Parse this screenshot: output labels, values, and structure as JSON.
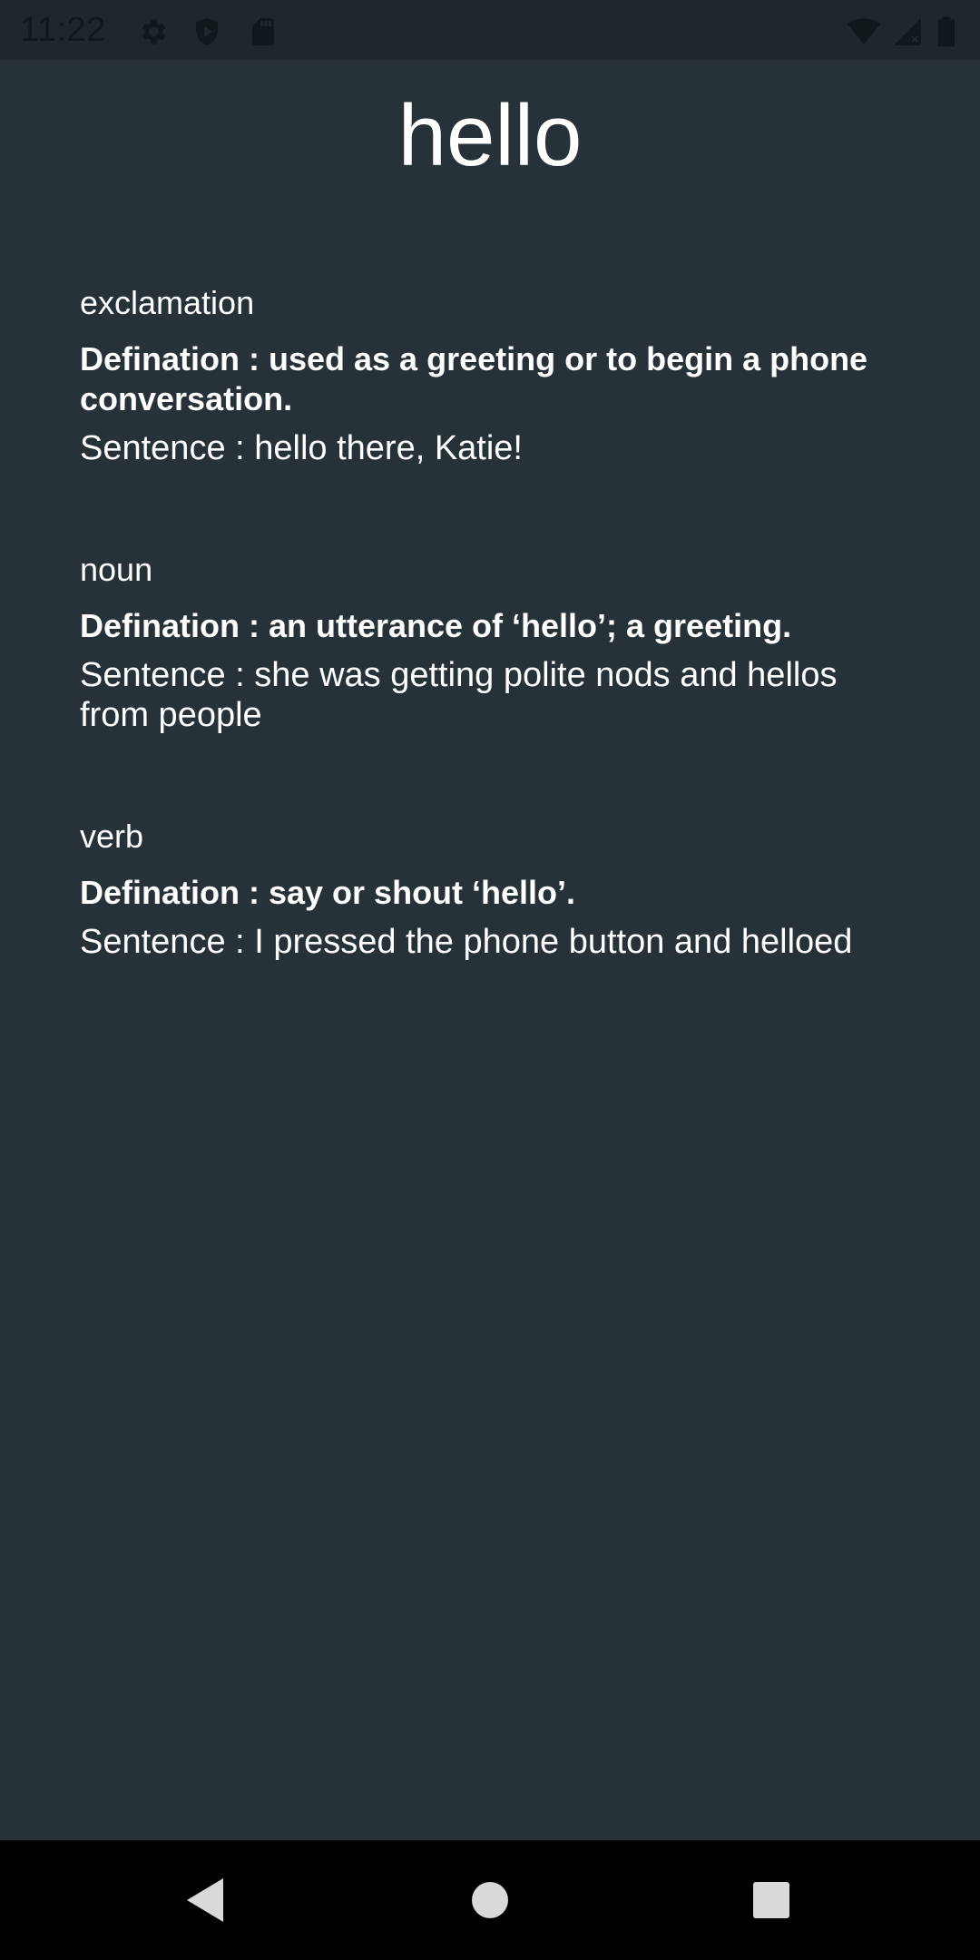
{
  "status_bar": {
    "time": "11:22",
    "left_icons": [
      "gear-icon",
      "shield-play-icon",
      "sd-card-icon"
    ],
    "right_icons": [
      "wifi-icon",
      "cell-signal-icon",
      "battery-icon"
    ]
  },
  "word": "hello",
  "entries": [
    {
      "part_of_speech": "exclamation",
      "definition": "Defination : used as a greeting or to begin a phone conversation.",
      "sentence": "Sentence  : hello there, Katie!"
    },
    {
      "part_of_speech": "noun",
      "definition": "Defination : an utterance of ‘hello’; a greeting.",
      "sentence": "Sentence  : she was getting polite nods and hellos from people"
    },
    {
      "part_of_speech": "verb",
      "definition": "Defination : say or shout ‘hello’.",
      "sentence": "Sentence  : I pressed the phone button and helloed"
    }
  ],
  "nav_bar": {
    "buttons": [
      "back-icon",
      "home-icon",
      "recents-icon"
    ]
  },
  "colors": {
    "background": "#263238",
    "status_bar": "#1f272c",
    "nav_bar": "#000000",
    "text": "#ffffff"
  }
}
